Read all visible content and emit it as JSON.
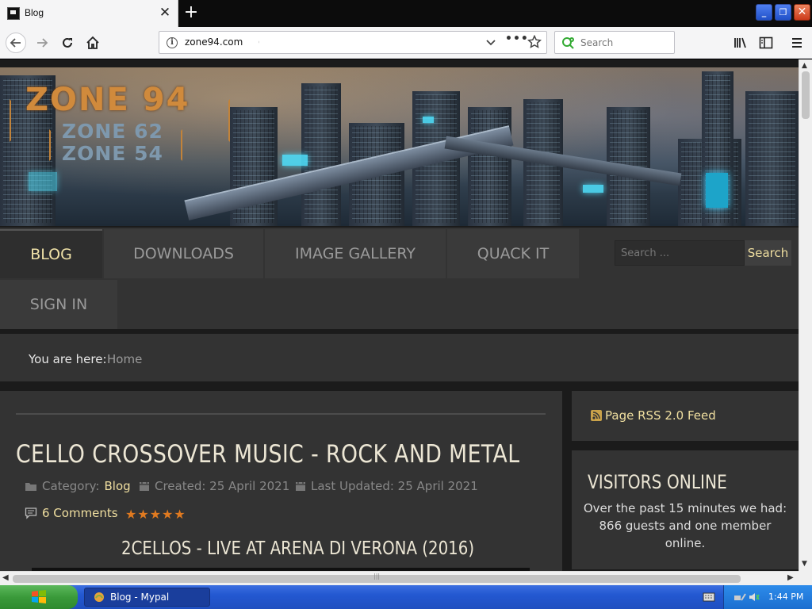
{
  "browser": {
    "tab_title": "Blog",
    "new_tab": "+",
    "url": "zone94.com",
    "search_placeholder": "Search"
  },
  "site": {
    "logo": {
      "main": "ZONE 94",
      "sub1": "ZONE 62",
      "sub2": "ZONE 54"
    },
    "nav": {
      "items": [
        "BLOG",
        "DOWNLOADS",
        "IMAGE GALLERY",
        "QUACK IT",
        "SIGN IN"
      ],
      "active": "BLOG",
      "search_placeholder": "Search ...",
      "search_button": "Search"
    },
    "breadcrumb": {
      "label": "You are here:",
      "current": "Home"
    },
    "article": {
      "title": "CELLO CROSSOVER MUSIC - ROCK AND METAL",
      "category_label": "Category:",
      "category": "Blog",
      "created": "Created: 25 April 2021",
      "updated": "Last Updated: 25 April 2021",
      "comments": "6 Comments",
      "rating": 5,
      "rating_stars": "★★★★★",
      "subtitle": "2CELLOS - LIVE AT ARENA DI VERONA (2016)"
    },
    "sidebar": {
      "rss": "Page RSS 2.0 Feed",
      "visitors_title": "VISITORS ONLINE",
      "visitors_text": "Over the past 15 minutes we had: 866 guests and one member online."
    }
  },
  "taskbar": {
    "task_label": "Blog - Mypal",
    "time": "1:44 PM"
  },
  "colors": {
    "accent": "#f0dfa0",
    "star": "#e07a20",
    "panel": "#333333",
    "page_bg": "#1b1b1b"
  }
}
